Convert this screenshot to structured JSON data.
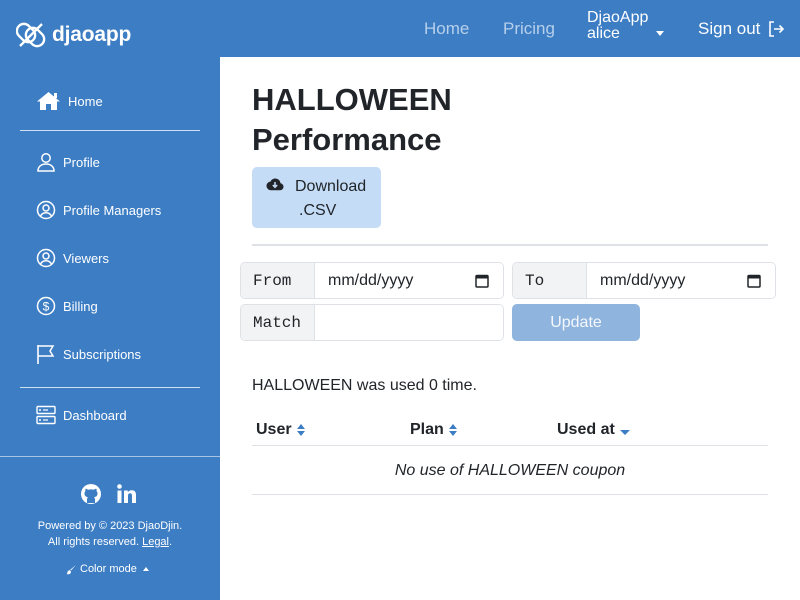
{
  "app": {
    "brand": "djaoapp",
    "nav": {
      "home": "Home",
      "pricing": "Pricing"
    },
    "user": {
      "org": "DjaoApp",
      "name": "alice"
    },
    "signout": "Sign out"
  },
  "sidebar": {
    "home": "Home",
    "items": [
      {
        "label": "Profile"
      },
      {
        "label": "Profile Managers"
      },
      {
        "label": "Viewers"
      },
      {
        "label": "Billing"
      },
      {
        "label": "Subscriptions"
      }
    ],
    "dashboard": "Dashboard",
    "footer": {
      "powered": "Powered by © 2023 DjaoDjin.",
      "rights": "All rights reserved.",
      "legal": "Legal",
      "color_mode": "Color mode"
    }
  },
  "main": {
    "title_line1": "HALLOWEEN",
    "title_line2": "Performance",
    "download": {
      "line1": "Download",
      "line2": ".CSV"
    },
    "filters": {
      "from_label": "From",
      "from_placeholder": "mm/dd/yyyy",
      "to_label": "To",
      "to_placeholder": "mm/dd/yyyy",
      "match_label": "Match",
      "match_value": "",
      "update": "Update"
    },
    "usage_text": "HALLOWEEN was used 0 time.",
    "table": {
      "columns": [
        "User",
        "Plan",
        "Used at"
      ],
      "empty": "No use of HALLOWEEN coupon"
    }
  },
  "colors": {
    "primary": "#3c7dc4",
    "download_bg": "#c5dcf7",
    "update_bg": "#8fb4dd",
    "sort_icon": "#3c7dc4"
  }
}
